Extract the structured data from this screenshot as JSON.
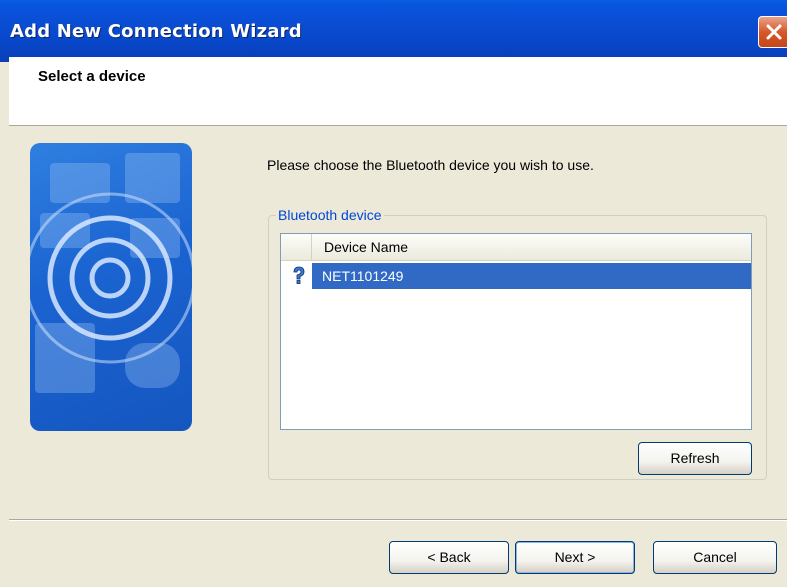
{
  "window": {
    "title": "Add New Connection Wizard"
  },
  "header": {
    "title": "Select a device"
  },
  "main": {
    "instruction": "Please choose the Bluetooth device you wish to use.",
    "group_label": "Bluetooth device",
    "device_list": {
      "columns": [
        "",
        "Device Name"
      ],
      "rows": [
        {
          "icon": "unknown-device-icon",
          "name": "NET1101249",
          "selected": true
        }
      ]
    },
    "refresh_label": "Refresh"
  },
  "footer": {
    "back_label": "< Back",
    "next_label": "Next >",
    "cancel_label": "Cancel"
  },
  "colors": {
    "titlebar": "#0a4fd6",
    "selection": "#316ac5",
    "group_label": "#0046d5"
  }
}
